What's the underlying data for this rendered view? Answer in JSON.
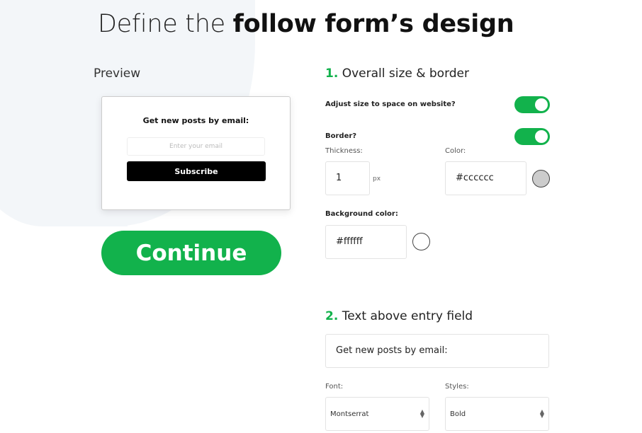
{
  "title": {
    "prefix": "Define the ",
    "bold": "follow form’s design"
  },
  "preview": {
    "label": "Preview",
    "heading": "Get new posts by email:",
    "email_placeholder": "Enter your email",
    "subscribe_label": "Subscribe"
  },
  "continue_label": "Continue",
  "section1": {
    "number": "1.",
    "title": "Overall size & border",
    "adjust_label": "Adjust size to space on website?",
    "adjust_on": true,
    "border_label": "Border?",
    "border_on": true,
    "thickness_label": "Thickness:",
    "thickness_value": "1",
    "thickness_unit": "px",
    "color_label": "Color:",
    "color_value": "#cccccc",
    "color_swatch": "#cccccc",
    "bg_label": "Background color:",
    "bg_value": "#ffffff",
    "bg_swatch": "#ffffff"
  },
  "section2": {
    "number": "2.",
    "title": "Text above entry field",
    "text_value": "Get new posts by email:",
    "font_label": "Font:",
    "font_value": "Montserrat",
    "styles_label": "Styles:",
    "styles_value": "Bold"
  },
  "colors": {
    "accent": "#12b24c",
    "subscribe_bg": "#000000"
  }
}
